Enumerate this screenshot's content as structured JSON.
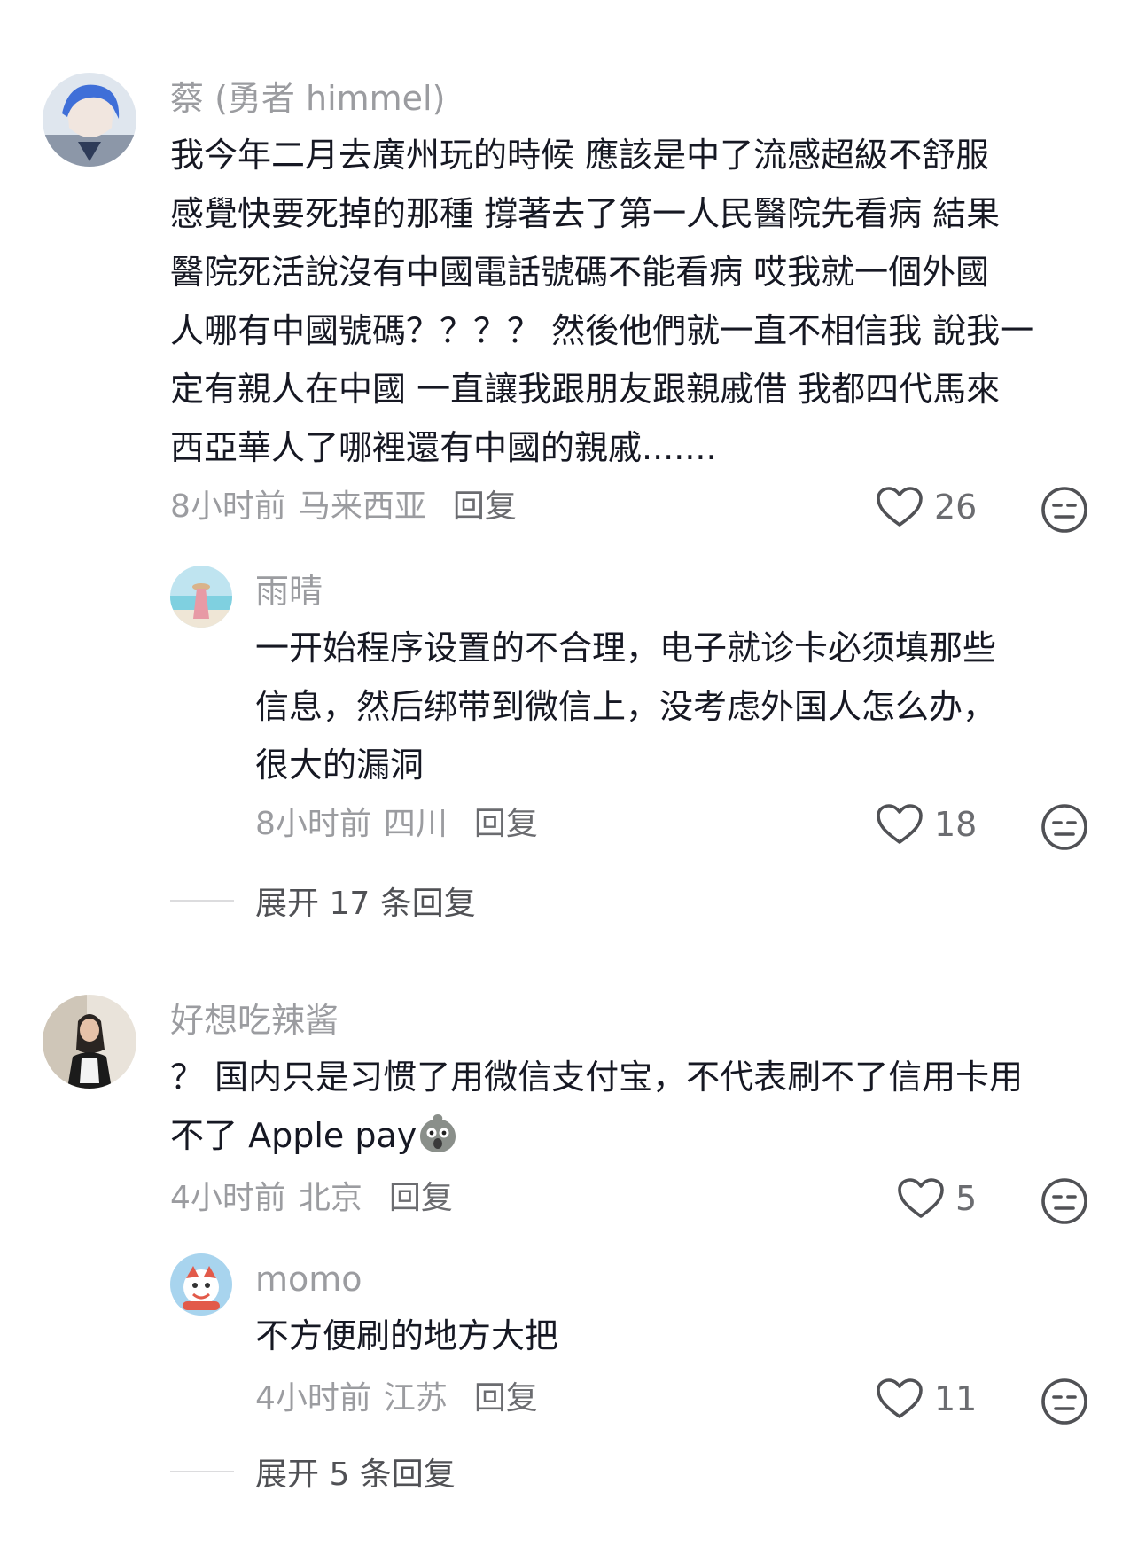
{
  "comments": [
    {
      "username": "蔡 (勇者 himmel)",
      "content": "我今年二月去廣州玩的時候 應該是中了流感超級不舒服\n感覺快要死掉的那種 撐著去了第一人民醫院先看病 結果\n醫院死活說沒有中國電話號碼不能看病 哎我就一個外國\n人哪有中國號碼？？？？ 然後他們就一直不相信我 說我一\n定有親人在中國 一直讓我跟朋友跟親戚借 我都四代馬來\n西亞華人了哪裡還有中國的親戚.......",
      "time": "8小时前",
      "location": "马来西亚",
      "reply_label": "回复",
      "likes": "26",
      "replies": [
        {
          "username": "雨晴",
          "content": "一开始程序设置的不合理，电子就诊卡必须填那些\n信息，然后绑带到微信上，没考虑外国人怎么办，\n很大的漏洞",
          "time": "8小时前",
          "location": "四川",
          "reply_label": "回复",
          "likes": "18"
        }
      ],
      "expand_label": "展开 17 条回复"
    },
    {
      "username": "好想吃辣酱",
      "content": "？ 国内只是习惯了用微信支付宝，不代表刷不了信用卡用\n不了 Apple pay",
      "emoji": "shocked-face-emoji",
      "time": "4小时前",
      "location": "北京",
      "reply_label": "回复",
      "likes": "5",
      "replies": [
        {
          "username": "momo",
          "content": "不方便刷的地方大把",
          "time": "4小时前",
          "location": "江苏",
          "reply_label": "回复",
          "likes": "11"
        }
      ],
      "expand_label": "展开 5 条回复"
    }
  ],
  "colors": {
    "text": "#161823",
    "secondary": "#9b9ca0",
    "icon": "#505155"
  }
}
